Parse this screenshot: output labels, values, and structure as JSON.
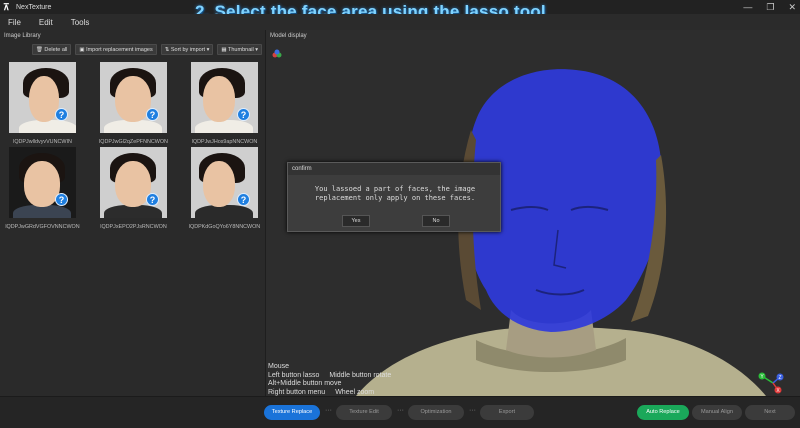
{
  "window": {
    "app_name": "NexTexture",
    "caption": "2. Select the face area using the lasso tool",
    "controls": [
      "—",
      "❐",
      "✕"
    ]
  },
  "menu": [
    "File",
    "Edit",
    "Tools"
  ],
  "library": {
    "title": "Image Library",
    "toolbar": {
      "delete_all": "Delete all",
      "import": "Import replacement images",
      "sort": "Sort by import",
      "view": "Thumbnail"
    },
    "items": [
      {
        "name": "lQDPJwlldvyvVUNCWIN",
        "pose": "left"
      },
      {
        "name": "lQDPJwGl2qZePFNNCWON",
        "pose": "front-left"
      },
      {
        "name": "lQDPJwJHos9apNNCWON",
        "pose": "right"
      },
      {
        "name": "lQDPJwGRdVGFOVNNCWON",
        "pose": "front"
      },
      {
        "name": "lQDPJxEPO2PJsRNCWON",
        "pose": "front"
      },
      {
        "name": "lQDPKdGoQYo6Y8NNCWON",
        "pose": "right"
      }
    ]
  },
  "viewport": {
    "title": "Model display",
    "help": {
      "title": "Mouse",
      "lines": [
        [
          "Left button lasso",
          "Middle button rotate"
        ],
        [
          "Alt+Middle button move",
          ""
        ],
        [
          "Right button menu",
          "Wheel zoom"
        ]
      ]
    },
    "axes": {
      "x": "X",
      "y": "Y",
      "z": "Z"
    }
  },
  "dialog": {
    "title": "confirm",
    "message": "You lassoed a part of faces, the image replacement only apply on these faces.",
    "yes": "Yes",
    "no": "No"
  },
  "bottom": {
    "texture_replace": "Texture Replace",
    "texture_edit": "Texture Edit",
    "optimization": "Optimization",
    "export": "Export",
    "auto_replace": "Auto Replace",
    "manual_align": "Manual Align",
    "next": "Next"
  },
  "colors": {
    "accent_blue": "#1a73d9",
    "accent_green": "#1aa85a",
    "selection": "#2f3bdc",
    "caption": "#7fd3ff"
  }
}
